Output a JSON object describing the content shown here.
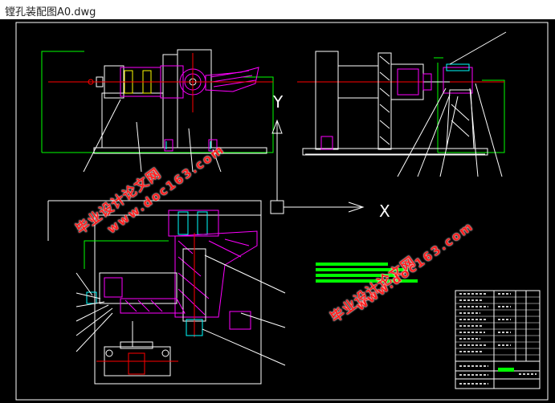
{
  "window": {
    "title": "镗孔装配图A0.dwg"
  },
  "drawing": {
    "axis_labels": {
      "y": "Y",
      "x": "X"
    },
    "colors": {
      "background": "#000000",
      "frame": "#ffffff",
      "green": "#00ff00",
      "magenta": "#ff00ff",
      "red": "#ff0000",
      "cyan": "#00ffff",
      "yellow": "#ffff00",
      "white": "#ffffff"
    }
  },
  "watermarks": [
    {
      "cn": "毕业设计论文网",
      "url": "www.doc163.com"
    },
    {
      "cn": "毕业设计论文网",
      "url": "www.doc163.com"
    }
  ]
}
